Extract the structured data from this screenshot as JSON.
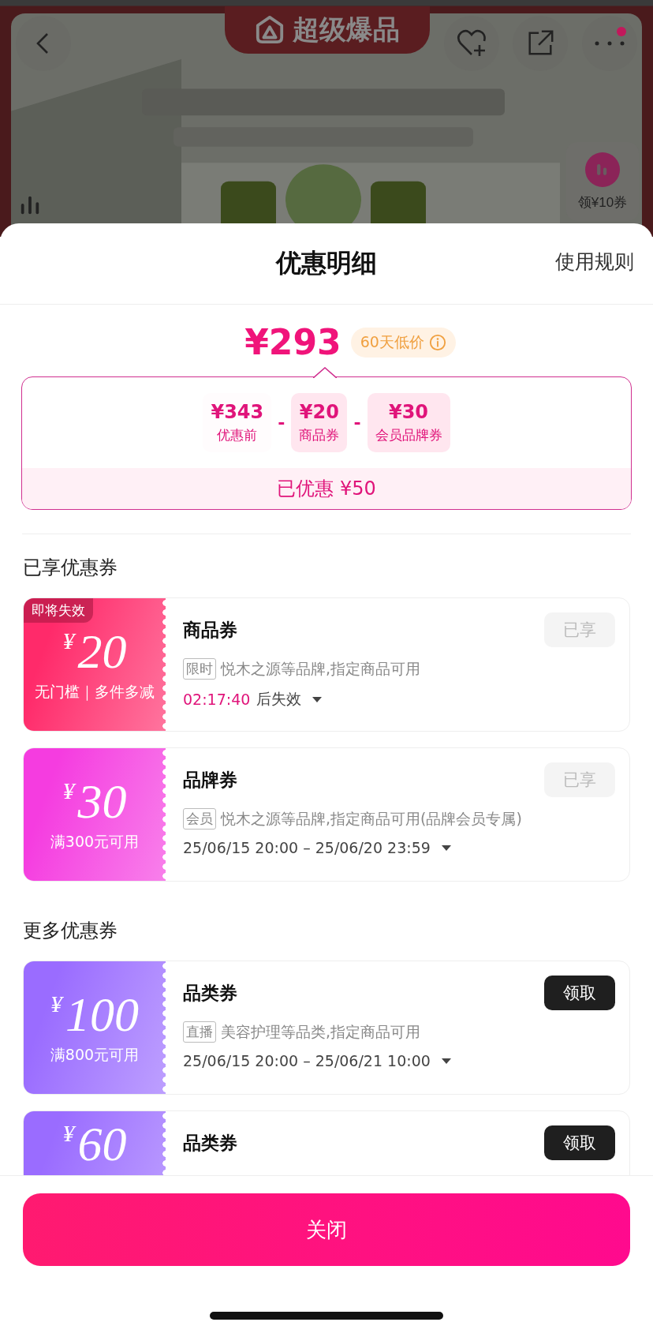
{
  "banner": {
    "badge": "超级爆品",
    "coupon_widget": "领¥10券"
  },
  "sheet": {
    "title": "优惠明细",
    "rules_link": "使用规则"
  },
  "price": {
    "final": "¥293",
    "badge": "60天低价"
  },
  "breakdown": {
    "items": [
      {
        "amount": "¥343",
        "label": "优惠前",
        "highlighted": false
      },
      {
        "amount": "¥20",
        "label": "商品券",
        "highlighted": true
      },
      {
        "amount": "¥30",
        "label": "会员品牌券",
        "highlighted": true
      }
    ],
    "operators": [
      "-",
      "-"
    ],
    "saved": "已优惠 ¥50"
  },
  "sections": [
    {
      "title": "已享优惠券",
      "coupons": [
        {
          "color": "#ff2a6a",
          "currency": "¥",
          "amount": "20",
          "condition": "无门槛｜多件多减",
          "flag": "即将失效",
          "title": "商品券",
          "tag": "限时",
          "desc": "悦木之源等品牌,指定商品可用",
          "countdown": "02:17:40",
          "time": "后失效",
          "action": {
            "label": "已享",
            "kind": "claimed"
          }
        },
        {
          "color": "#f53ce0",
          "currency": "¥",
          "amount": "30",
          "condition": "满300元可用",
          "title": "品牌券",
          "tag": "会员",
          "desc": "悦木之源等品牌,指定商品可用(品牌会员专属)",
          "time": "25/06/15 20:00 – 25/06/20 23:59",
          "action": {
            "label": "已享",
            "kind": "claimed"
          }
        }
      ]
    },
    {
      "title": "更多优惠券",
      "coupons": [
        {
          "color": "#9a6cff",
          "currency": "¥",
          "amount": "100",
          "condition": "满800元可用",
          "title": "品类券",
          "tag": "直播",
          "desc": "美容护理等品类,指定商品可用",
          "time": "25/06/15 20:00 – 25/06/21 10:00",
          "action": {
            "label": "领取",
            "kind": "claim"
          }
        },
        {
          "color": "#9a6cff",
          "currency": "¥",
          "amount": "60",
          "title": "品类券",
          "action": {
            "label": "领取",
            "kind": "claim"
          }
        }
      ]
    }
  ],
  "close_button": "关闭"
}
